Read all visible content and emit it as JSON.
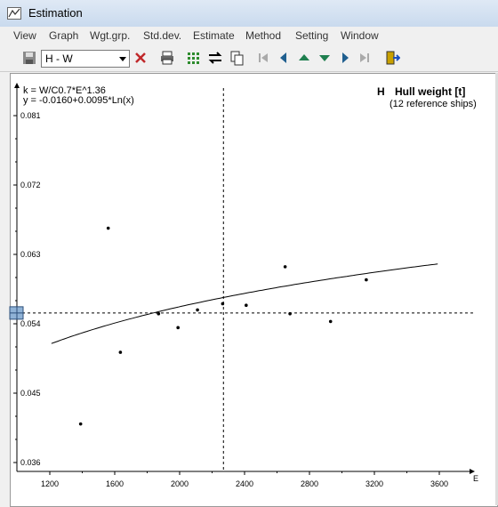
{
  "window": {
    "title": "Estimation"
  },
  "menu": [
    "View",
    "Graph",
    "Wgt.grp.",
    "Std.dev.",
    "Estimate",
    "Method",
    "Setting",
    "Window"
  ],
  "toolbar": {
    "selector_value": "H - W",
    "icons": [
      "save-icon",
      "delete-icon",
      "print-icon",
      "grid-icon",
      "swap-icon",
      "copy-icon",
      "first-icon",
      "prev-icon",
      "up-icon",
      "down-icon",
      "next-icon",
      "last-icon",
      "exit-icon"
    ]
  },
  "chart_text": {
    "formula_k": "k = W/C0.7*E^1.36",
    "formula_y": "y = -0.0160+0.0095*Ln(x)",
    "right_code": "H",
    "right_title": "Hull weight [t]",
    "right_sub": "(12 reference ships)"
  },
  "chart_data": {
    "type": "scatter",
    "xlabel": "E",
    "ylabel": "",
    "xlim": [
      1200,
      3600
    ],
    "ylim": [
      0.036,
      0.081
    ],
    "x_ticks": [
      "1200",
      "1600",
      "2000",
      "2400",
      "2800",
      "3200",
      "3600"
    ],
    "y_ticks": [
      "0.081",
      "0.072",
      "0.063",
      "0.054",
      "0.045",
      "0.036"
    ],
    "points": [
      {
        "x": 1390,
        "y": 0.041
      },
      {
        "x": 1560,
        "y": 0.0664
      },
      {
        "x": 1635,
        "y": 0.0503
      },
      {
        "x": 1870,
        "y": 0.0553
      },
      {
        "x": 1990,
        "y": 0.0535
      },
      {
        "x": 2110,
        "y": 0.0558
      },
      {
        "x": 2265,
        "y": 0.0566
      },
      {
        "x": 2410,
        "y": 0.0564
      },
      {
        "x": 2650,
        "y": 0.0614
      },
      {
        "x": 2680,
        "y": 0.0553
      },
      {
        "x": 2930,
        "y": 0.0543
      },
      {
        "x": 3150,
        "y": 0.0597
      }
    ],
    "curve": {
      "a": -0.016,
      "b": 0.0095,
      "x_from": 1210,
      "x_to": 3600
    },
    "crosshair": {
      "x": 2270,
      "y": 0.0554
    },
    "colors": {
      "points": "#000000",
      "curve": "#000000",
      "marker": "#8fb2d6"
    }
  }
}
